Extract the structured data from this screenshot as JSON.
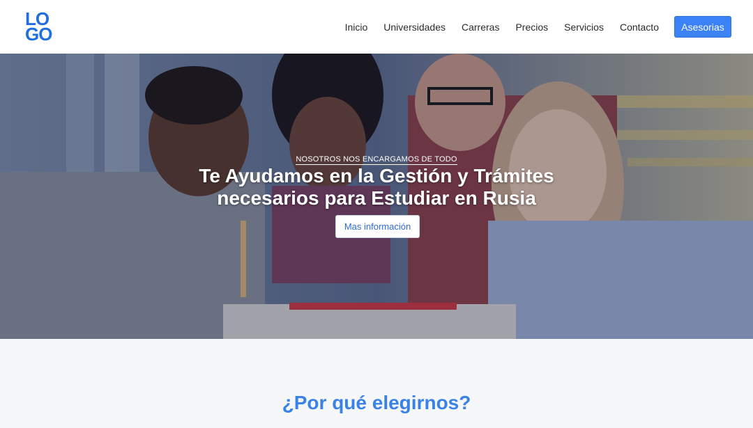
{
  "logo": {
    "line1": "LO",
    "line2": "GO"
  },
  "nav": {
    "links": [
      "Inicio",
      "Universidades",
      "Carreras",
      "Precios",
      "Servicios",
      "Contacto"
    ],
    "cta": "Asesorias"
  },
  "hero": {
    "kicker": "NOSOTROS NOS ENCARGAMOS DE TODO",
    "title_line1": "Te Ayudamos en la Gestión y Trámites",
    "title_line2": "necesarios para Estudiar en Rusia",
    "button": "Mas información",
    "image_description": "students-group-photo"
  },
  "section": {
    "title": "¿Por qué elegirnos?"
  },
  "colors": {
    "accent": "#3b82f6",
    "title_blue": "#3b82e6",
    "logo_blue": "#1f6fe0"
  }
}
